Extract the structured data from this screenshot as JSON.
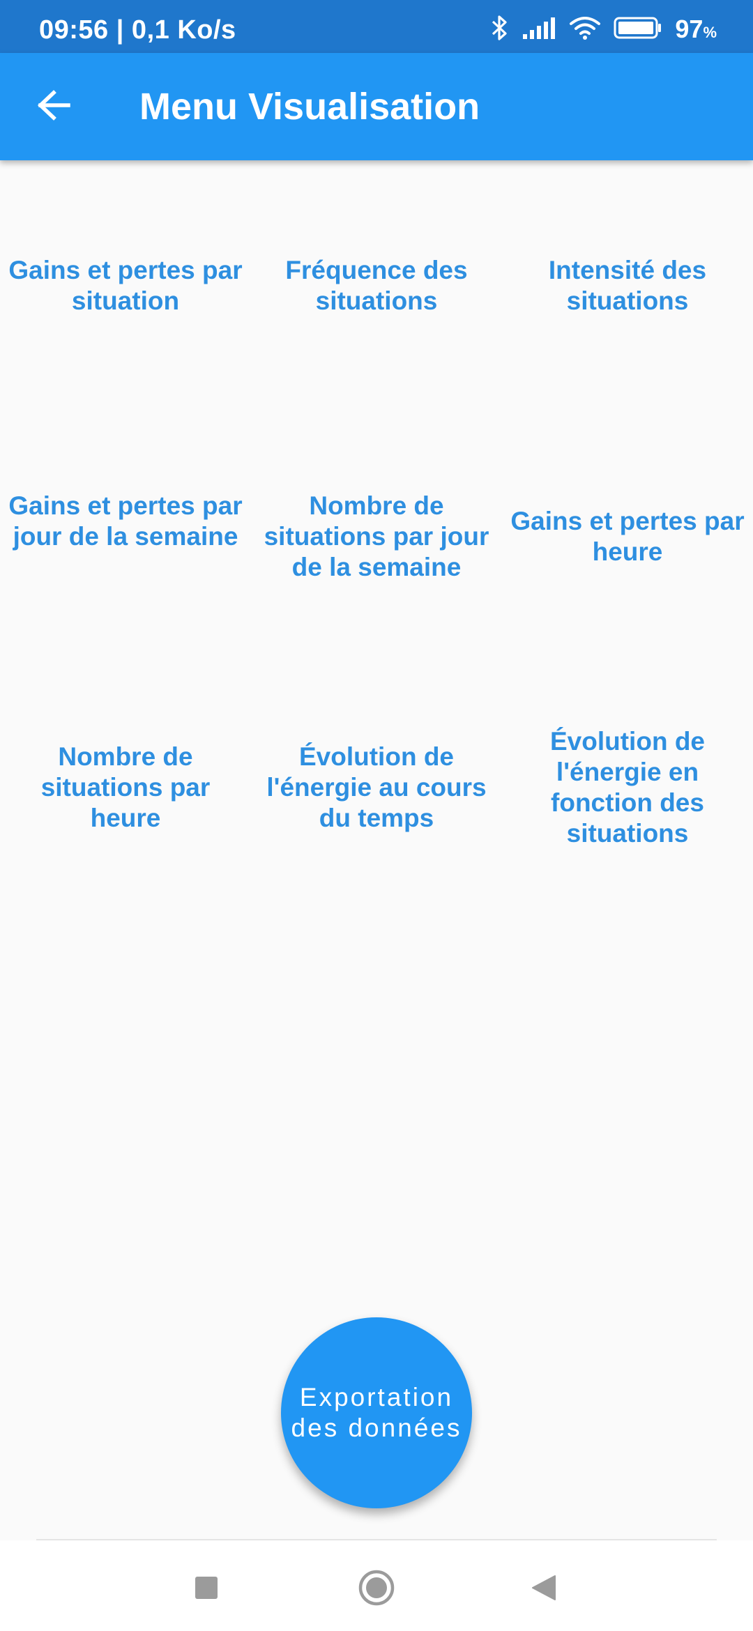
{
  "status_bar": {
    "time_speed": "09:56 | 0,1 Ko/s",
    "battery_value": "97",
    "battery_unit": "%",
    "icons": [
      "bluetooth-icon",
      "signal-icon",
      "wifi-icon",
      "battery-icon"
    ]
  },
  "app_bar": {
    "title": "Menu Visualisation",
    "back_icon": "arrow-left-icon"
  },
  "menu": {
    "items": [
      {
        "label": "Gains et pertes par situation"
      },
      {
        "label": "Fréquence des situations"
      },
      {
        "label": "Intensité des situations"
      },
      {
        "label": "Gains et pertes par jour de la semaine"
      },
      {
        "label": "Nombre de situations par jour de la semaine"
      },
      {
        "label": "Gains et pertes par heure"
      },
      {
        "label": "Nombre de situations par heure"
      },
      {
        "label": "Évolution de l'énergie au cours du temps"
      },
      {
        "label": "Évolution de l'énergie en fonction des situations"
      }
    ]
  },
  "fab": {
    "label": "Exportation des données"
  },
  "navigation": {
    "buttons": [
      "recents-square-icon",
      "home-circle-icon",
      "back-triangle-icon"
    ]
  },
  "colors": {
    "status_bar": "#1f77cc",
    "primary": "#2196f3",
    "menu_text": "#2e8fe0",
    "background": "#fafafa"
  }
}
